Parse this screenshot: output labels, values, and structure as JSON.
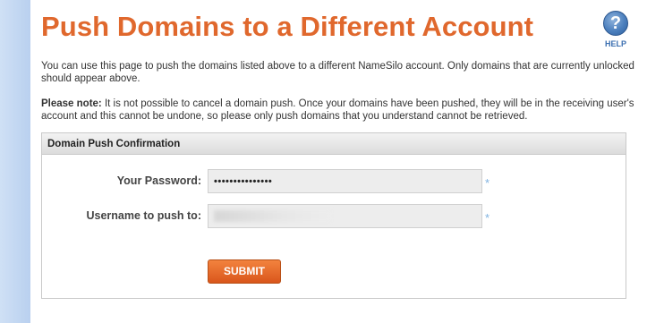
{
  "page": {
    "title": "Push Domains to a Different Account",
    "help_label": "HELP",
    "help_glyph": "?"
  },
  "intro_text": "You can use this page to push the domains listed above to a different NameSilo account. Only domains that are currently unlocked should appear above.",
  "note": {
    "label": "Please note:",
    "text": " It is not possible to cancel a domain push. Once your domains have been pushed, they will be in the receiving user's account and this cannot be undone, so please only push domains that you understand cannot be retrieved."
  },
  "form": {
    "header": "Domain Push Confirmation",
    "password_label": "Your Password:",
    "password_value": "•••••••••••••••",
    "username_label": "Username to push to:",
    "required_marker": "*",
    "submit_label": "SUBMIT"
  },
  "colors": {
    "title": "#e0682d",
    "accent_blue": "#3b6fb0",
    "submit": "#e56a2b"
  },
  "icons": [
    "help-icon"
  ]
}
